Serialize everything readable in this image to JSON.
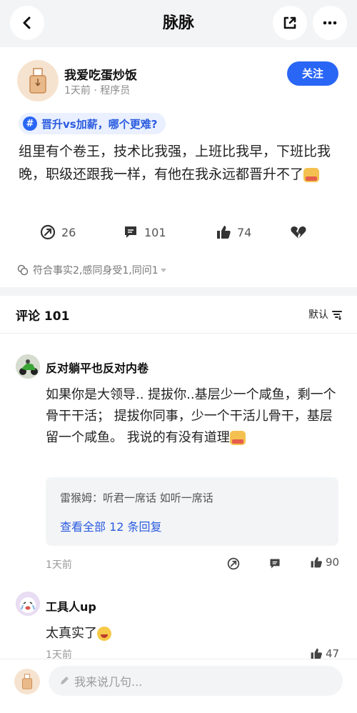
{
  "header": {
    "title": "脉脉"
  },
  "post": {
    "author": "我爱吃蛋炒饭",
    "meta": "1天前 · 程序员",
    "follow_label": "关注",
    "topic": "晋升vs加薪，哪个更难?",
    "body": "组里有个卷王，技术比我强，上班比我早，下班比我晚，职级还跟我一样，有他在我永远都晋升不了",
    "stats": {
      "shares": "26",
      "comments": "101",
      "likes": "74"
    },
    "reactions": "符合事实2,感同身受1,同问1"
  },
  "comments_section": {
    "title": "评论 101",
    "sort_label": "默认"
  },
  "comments": [
    {
      "author": "反对躺平也反对内卷",
      "body": "如果你是大领导.. 提拔你..基层少一个咸鱼，剩一个骨干干活； 提拔你同事，少一个干活儿骨干，基层留一个咸鱼。 我说的有没有道理",
      "reply_author": "雷猴姆：",
      "reply_text": "听君一席话 如听一席话",
      "view_all": "查看全部 12 条回复",
      "time": "1天前",
      "likes": "90"
    },
    {
      "author": "工具人up",
      "body": "太真实了",
      "time": "1天前",
      "likes": "47"
    }
  ],
  "input": {
    "placeholder": "我来说几句..."
  },
  "colors": {
    "accent": "#2a66f5",
    "link": "#2a5be0",
    "background_gray": "#f3f4f6"
  }
}
